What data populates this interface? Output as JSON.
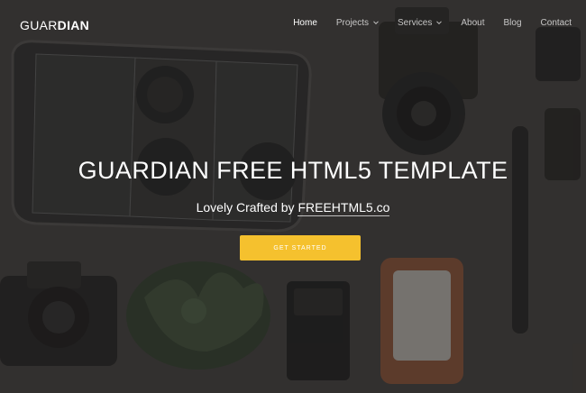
{
  "brand": {
    "light": "GUAR",
    "bold": "DIAN"
  },
  "nav": {
    "items": [
      {
        "label": "Home",
        "active": true,
        "dropdown": false
      },
      {
        "label": "Projects",
        "active": false,
        "dropdown": true
      },
      {
        "label": "Services",
        "active": false,
        "dropdown": true
      },
      {
        "label": "About",
        "active": false,
        "dropdown": false
      },
      {
        "label": "Blog",
        "active": false,
        "dropdown": false
      },
      {
        "label": "Contact",
        "active": false,
        "dropdown": false
      }
    ]
  },
  "hero": {
    "title": "GUARDIAN FREE HTML5 TEMPLATE",
    "subtitle_prefix": "Lovely Crafted by",
    "subtitle_link": "FREEHTML5.co",
    "cta_label": "GET STARTED"
  },
  "colors": {
    "accent": "#f5c12e",
    "overlay": "#3b3937",
    "text": "#ffffff"
  }
}
